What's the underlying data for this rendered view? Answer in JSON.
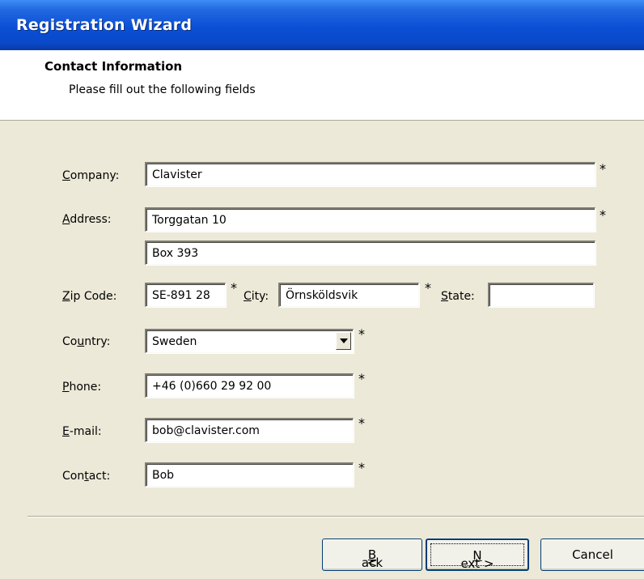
{
  "window": {
    "title": "Registration Wizard"
  },
  "header": {
    "title": "Contact Information",
    "subtitle": "Please fill out the following fields"
  },
  "form": {
    "company": {
      "label_pre": "",
      "label_key": "C",
      "label_post": "ompany:",
      "value": "Clavister",
      "required": "*"
    },
    "address": {
      "label_pre": "",
      "label_key": "A",
      "label_post": "ddress:",
      "value1": "Torggatan 10",
      "value2": "Box 393",
      "required": "*"
    },
    "zip": {
      "label_pre": "",
      "label_key": "Z",
      "label_post": "ip Code:",
      "value": "SE-891 28",
      "required": "*"
    },
    "city": {
      "label_pre": "",
      "label_key": "C",
      "label_post": "ity:",
      "value": "Örnsköldsvik",
      "required": "*"
    },
    "state": {
      "label_pre": "",
      "label_key": "S",
      "label_post": "tate:",
      "value": ""
    },
    "country": {
      "label_pre": "Co",
      "label_key": "u",
      "label_post": "ntry:",
      "value": "Sweden",
      "required": "*"
    },
    "phone": {
      "label_pre": "",
      "label_key": "P",
      "label_post": "hone:",
      "value": "+46 (0)660 29 92 00",
      "required": "*"
    },
    "email": {
      "label_pre": "",
      "label_key": "E",
      "label_post": "-mail:",
      "value": "bob@clavister.com",
      "required": "*"
    },
    "contact": {
      "label_pre": "Con",
      "label_key": "t",
      "label_post": "act:",
      "value": "Bob",
      "required": "*"
    }
  },
  "buttons": {
    "back": {
      "pre": "< ",
      "key": "B",
      "post": "ack"
    },
    "next": {
      "pre": "",
      "key": "N",
      "post": "ext >"
    },
    "cancel": "Cancel"
  }
}
